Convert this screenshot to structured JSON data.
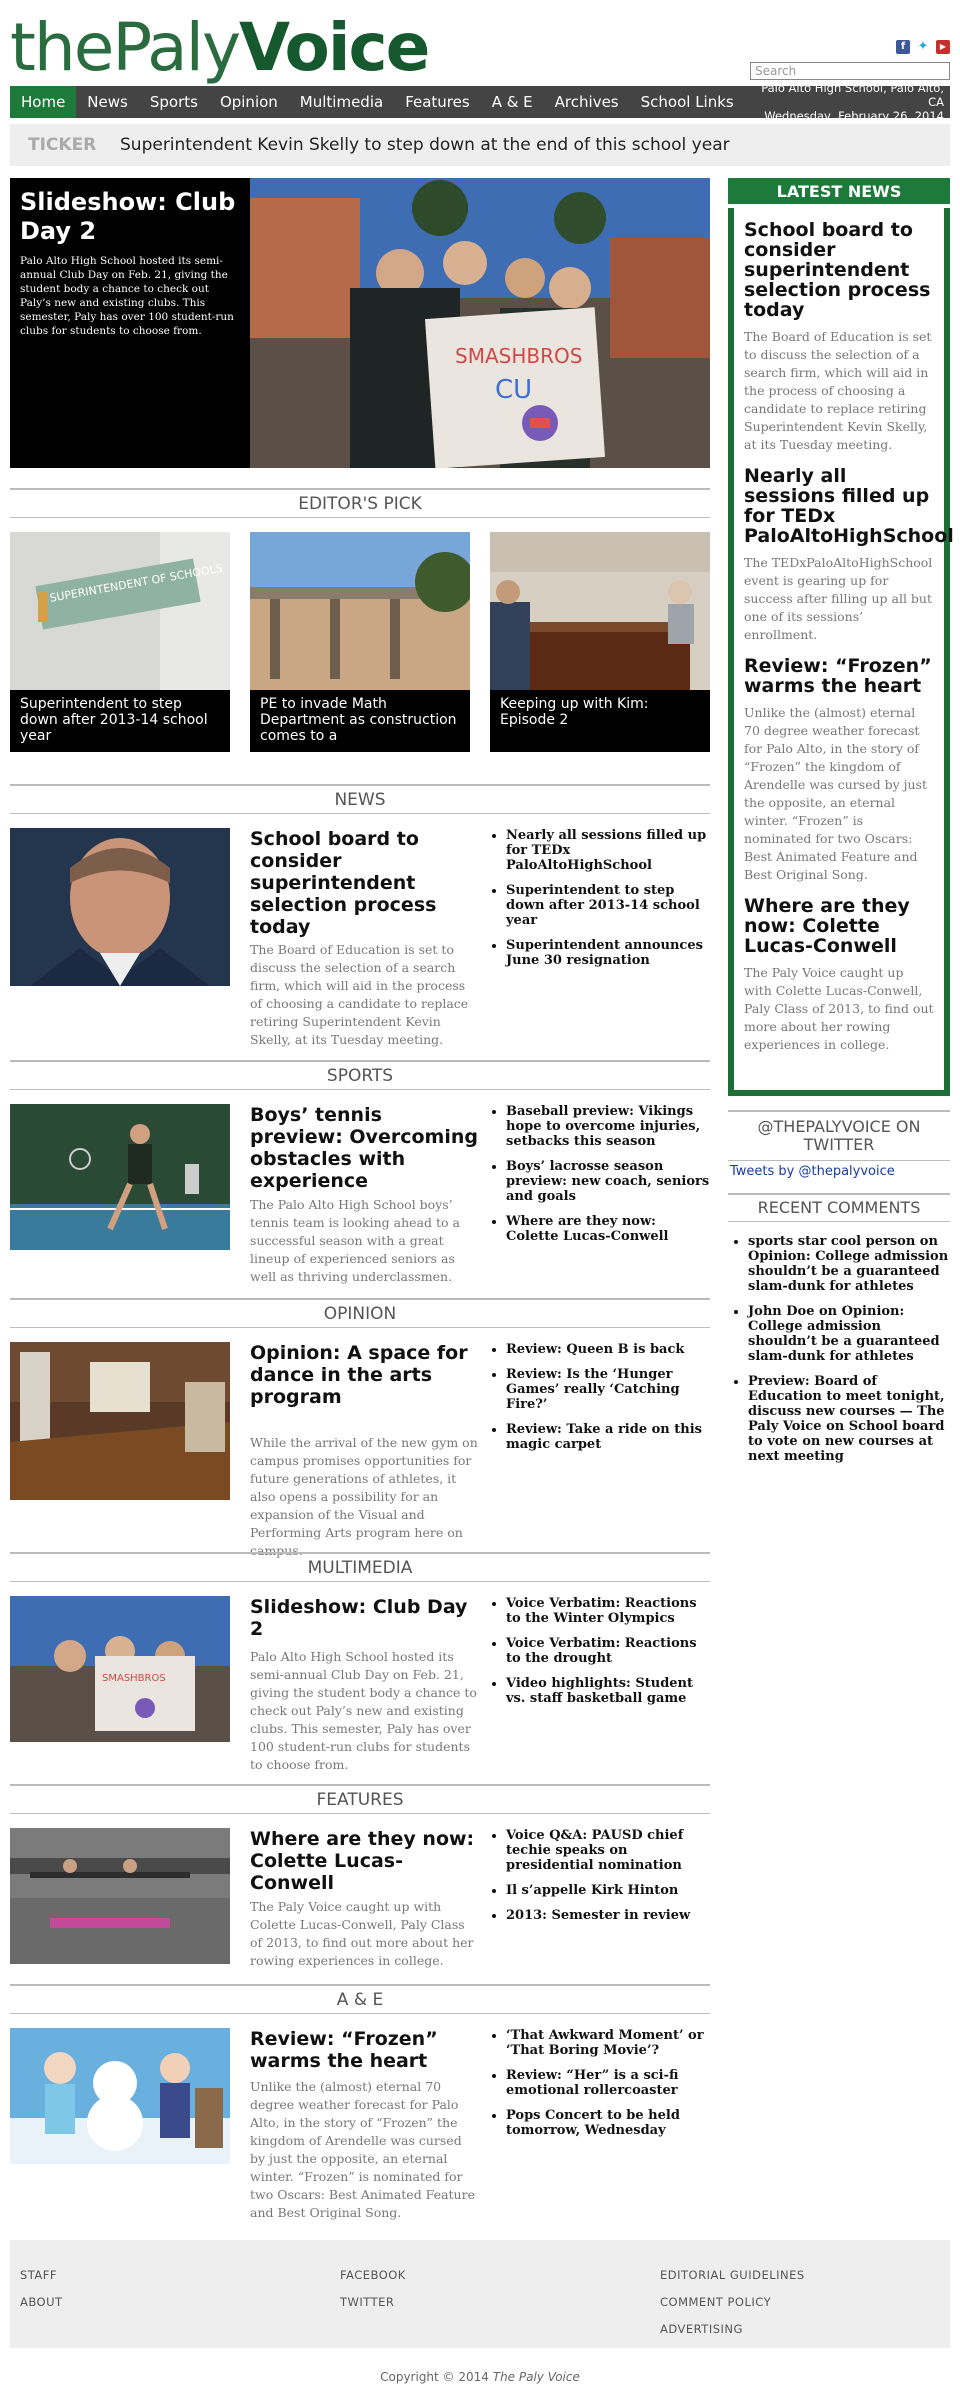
{
  "site": {
    "logo_thin": "the",
    "logo_mid": "Paly",
    "logo_bold": "Voice",
    "search_placeholder": "Search",
    "location": "Palo Alto High School, Palo Alto, CA",
    "date": "Wednesday, February 26, 2014"
  },
  "social": [
    "facebook-icon",
    "twitter-icon",
    "youtube-icon"
  ],
  "nav": [
    "Home",
    "News",
    "Sports",
    "Opinion",
    "Multimedia",
    "Features",
    "A & E",
    "Archives",
    "School Links"
  ],
  "ticker": {
    "label": "TICKER",
    "text": "Superintendent Kevin Skelly to step down at the end of this school year"
  },
  "hero": {
    "title": "Slideshow: Club Day 2",
    "summary": "Palo Alto High School hosted its semi-annual Club Day on Feb. 21, giving the student body a chance to check out Paly’s new and existing clubs. This semester, Paly has over 100 student-run clubs for students to choose from.",
    "sign_text": "SMASHBROS",
    "sign_sub": "CU"
  },
  "editors_pick": {
    "heading": "EDITOR'S PICK",
    "items": [
      "Superintendent to step down after 2013-14 school year",
      "PE to invade Math Department as construction comes to a",
      "Keeping up with Kim: Episode 2"
    ],
    "sign_text": "SUPERINTENDENT OF SCHOOLS"
  },
  "sections": [
    {
      "heading": "NEWS",
      "title": "School board to consider superintendent selection process today",
      "summary": "The Board of Education is set to discuss the selection of a search firm, which will aid in the process of choosing a candidate to replace retiring Superintendent Kevin Skelly, at its Tuesday meeting.",
      "links": [
        "Nearly all sessions filled up for TEDx PaloAltoHighSchool",
        "Superintendent to step down after 2013-14 school year",
        "Superintendent announces June 30 resignation"
      ]
    },
    {
      "heading": "SPORTS",
      "title": "Boys’ tennis preview: Overcoming obstacles with experience",
      "summary": "The Palo Alto High School boys’ tennis team is looking ahead to a successful season with a great lineup of experienced seniors as well as thriving underclassmen.",
      "links": [
        "Baseball preview: Vikings hope to overcome injuries, setbacks this season",
        "Boys’ lacrosse season preview: new coach, seniors and goals",
        "Where are they now: Colette Lucas-Conwell"
      ]
    },
    {
      "heading": "OPINION",
      "title": "Opinion: A space for dance in the arts program",
      "summary": "While the arrival of the new gym on campus promises opportunities for future generations of athletes, it also opens a possibility for an expansion of the Visual and Performing Arts program here on campus.",
      "links": [
        "Review: Queen B is back",
        "Review: Is the ‘Hunger Games’ really ‘Catching Fire?’",
        "Review: Take a ride on this magic carpet"
      ]
    },
    {
      "heading": "MULTIMEDIA",
      "title": "Slideshow: Club Day 2",
      "summary": "Palo Alto High School hosted its semi-annual Club Day on Feb. 21, giving the student body a chance to check out Paly’s new and existing clubs. This semester, Paly has over 100 student-run clubs for students to choose from.",
      "links": [
        "Voice Verbatim: Reactions to the Winter Olympics",
        "Voice Verbatim: Reactions to the drought",
        "Video highlights: Student vs. staff basketball game"
      ]
    },
    {
      "heading": "FEATURES",
      "title": "Where are they now: Colette Lucas-Conwell",
      "summary": "The Paly Voice caught up with Colette Lucas-Conwell, Paly Class of 2013, to find out more about her rowing experiences in college.",
      "links": [
        "Voice Q&A: PAUSD chief techie speaks on presidential nomination",
        "Il s’appelle Kirk Hinton",
        "2013: Semester in review"
      ]
    },
    {
      "heading": "A & E",
      "title": "Review: “Frozen” warms the heart",
      "summary": "Unlike the (almost) eternal 70 degree weather forecast for Palo Alto, in the story of “Frozen” the kingdom of Arendelle was cursed by just the opposite, an eternal winter. “Frozen” is nominated for two Oscars: Best Animated Feature and Best Original Song.",
      "links": [
        "‘That Awkward Moment’ or ‘That Boring Movie’?",
        "Review: “Her” is a sci-fi emotional rollercoaster",
        "Pops Concert to be held tomorrow, Wednesday"
      ]
    }
  ],
  "latest": {
    "heading": "LATEST NEWS",
    "items": [
      {
        "title": "School board to consider superintendent selection process today",
        "summary": "The Board of Education is set to discuss the selection of a search firm, which will aid in the process of choosing a candidate to replace retiring Superintendent Kevin Skelly, at its Tuesday meeting."
      },
      {
        "title": "Nearly all sessions filled up for TEDx PaloAltoHighSchool",
        "summary": "The TEDxPaloAltoHighSchool event is gearing up for success after filling up all but one of its sessions’ enrollment."
      },
      {
        "title": "Review: “Frozen” warms the heart",
        "summary": "Unlike the (almost) eternal 70 degree weather forecast for Palo Alto, in the story of “Frozen” the kingdom of Arendelle was cursed by just the opposite, an eternal winter. “Frozen” is nominated for two Oscars: Best Animated Feature and Best Original Song."
      },
      {
        "title": "Where are they now: Colette Lucas-Conwell",
        "summary": "The Paly Voice caught up with Colette Lucas-Conwell, Paly Class of 2013, to find out more about her rowing experiences in college."
      }
    ]
  },
  "twitter": {
    "heading": "@THEPALYVOICE ON TWITTER",
    "link": "Tweets by @thepalyvoice"
  },
  "recent": {
    "heading": "RECENT COMMENTS",
    "items": [
      "sports star cool person on Opinion: College admission shouldn’t be a guaranteed slam-dunk for athletes",
      "John Doe on Opinion: College admission shouldn’t be a guaranteed slam-dunk for athletes",
      "Preview: Board of Education to meet tonight, discuss new courses — The Paly Voice on School board to vote on new courses at next meeting"
    ]
  },
  "footer": {
    "col1": [
      "STAFF",
      "ABOUT"
    ],
    "col2": [
      "FACEBOOK",
      "TWITTER"
    ],
    "col3": [
      "EDITORIAL GUIDELINES",
      "COMMENT POLICY",
      "ADVERTISING"
    ]
  },
  "copyright": {
    "prefix": "Copyright © 2014 ",
    "name": "The Paly Voice"
  },
  "colors": {
    "brand_green": "#1d6e37",
    "nav_bg": "#444444",
    "nav_active": "#1d7a3b"
  }
}
